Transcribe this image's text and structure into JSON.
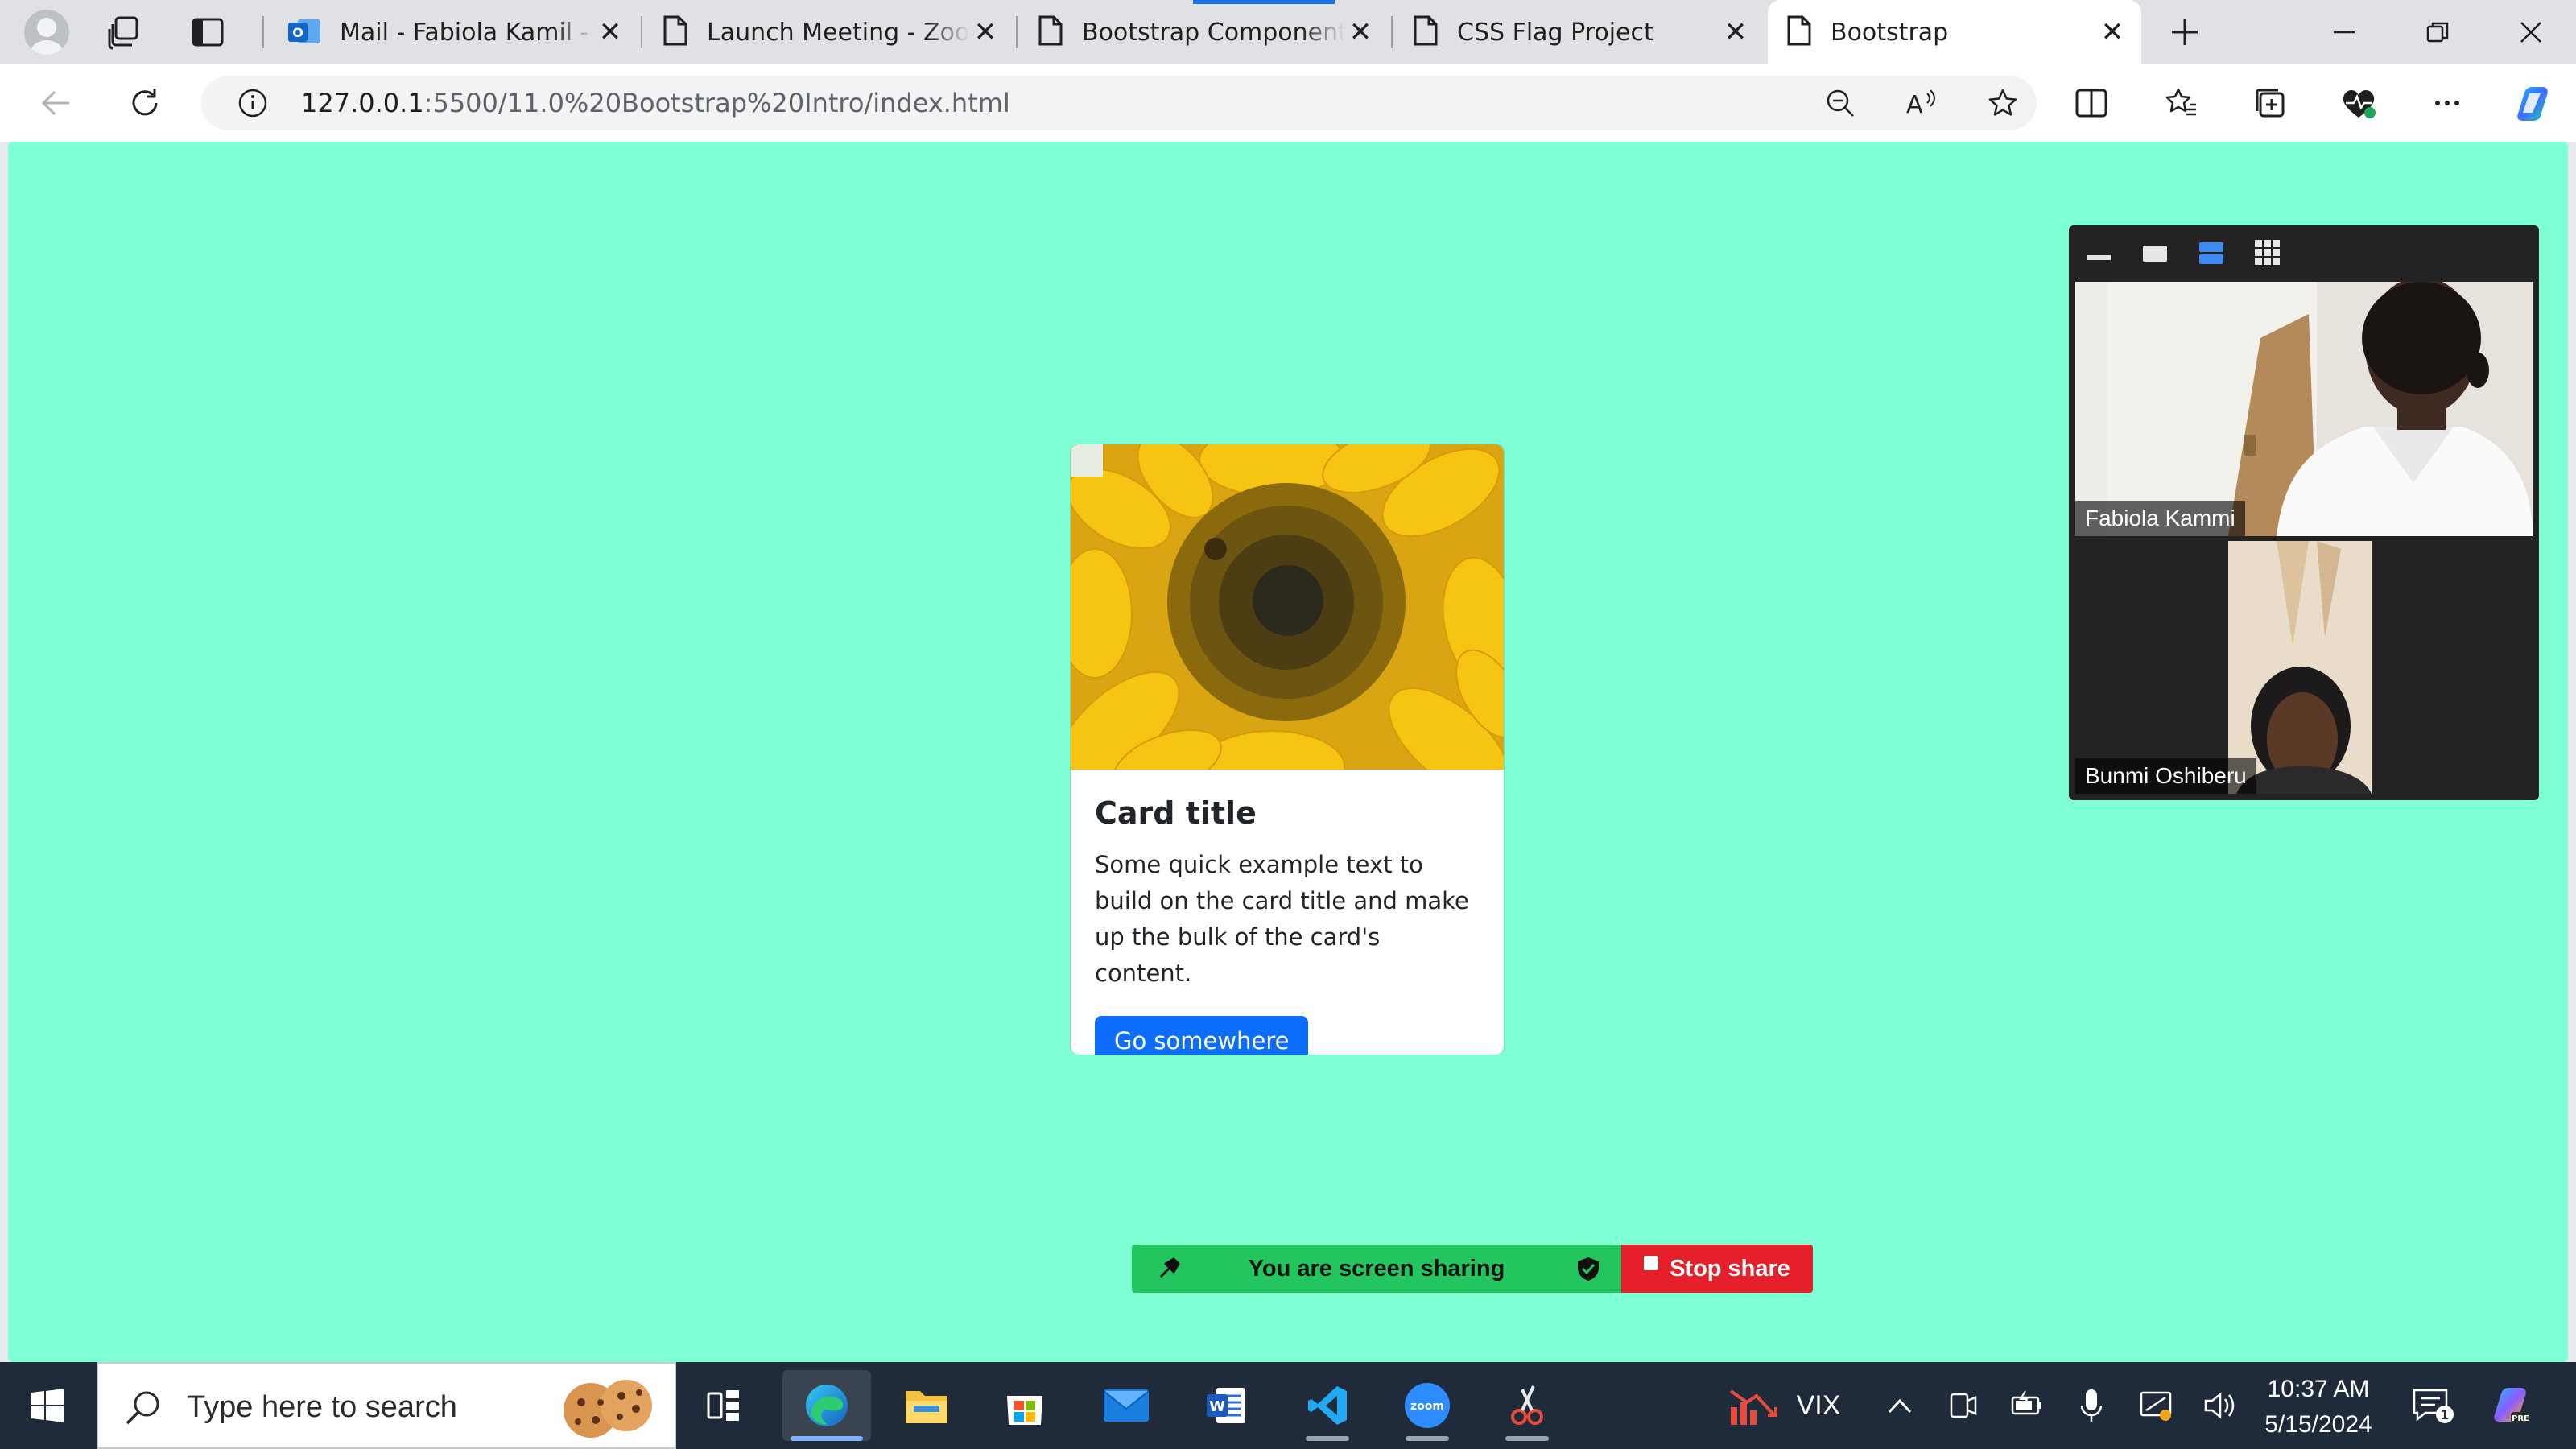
{
  "browser": {
    "tabs": [
      {
        "title": "Mail - Fabiola Kamil - Outlook",
        "icon": "outlook-icon",
        "active": false
      },
      {
        "title": "Launch Meeting - Zoom",
        "icon": "page-icon",
        "active": false
      },
      {
        "title": "Bootstrap Components",
        "icon": "page-icon",
        "active": false
      },
      {
        "title": "CSS Flag Project",
        "icon": "page-icon",
        "active": false
      },
      {
        "title": "Bootstrap",
        "icon": "page-icon",
        "active": true
      }
    ],
    "address": {
      "host": "127.0.0.1",
      "path": ":5500/11.0%20Bootstrap%20Intro/index.html"
    },
    "colors": {
      "tabstrip": "#dfe1e5",
      "accent": "#1a73e8"
    }
  },
  "page": {
    "background": "#7fffd4",
    "card": {
      "image": "sunflower",
      "title": "Card title",
      "text": "Some quick example text to build on the card title and make up the bulk of the card's content.",
      "button": "Go somewhere",
      "button_color": "#0d6efd"
    }
  },
  "zoom": {
    "participants": [
      {
        "name": "Fabiola Kammi"
      },
      {
        "name": "Bunmi Oshiberu"
      }
    ],
    "share_bar": {
      "status": "You are screen sharing",
      "stop_label": "Stop share",
      "status_color": "#22c55e",
      "stop_color": "#e5202a"
    }
  },
  "taskbar": {
    "search_placeholder": "Type here to search",
    "weather": "VIX",
    "time": "10:37 AM",
    "date": "5/15/2024",
    "notification_count": "1"
  }
}
